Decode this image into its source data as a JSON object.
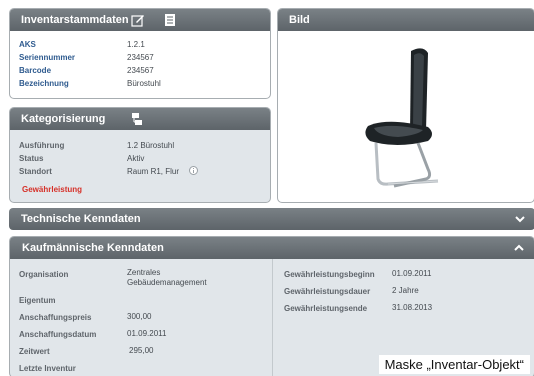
{
  "inventory": {
    "title": "Inventarstammdaten",
    "rows": [
      {
        "label": "AKS",
        "value": "1.2.1"
      },
      {
        "label": "Seriennummer",
        "value": "234567"
      },
      {
        "label": "Barcode",
        "value": "234567"
      },
      {
        "label": "Bezeichnung",
        "value": "Bürostuhl"
      }
    ]
  },
  "image_panel": {
    "title": "Bild"
  },
  "categorization": {
    "title": "Kategorisierung",
    "rows": [
      {
        "label": "Ausführung",
        "value": "1.2 Bürostuhl"
      },
      {
        "label": "Status",
        "value": "Aktiv"
      },
      {
        "label": "Standort",
        "value": "Raum R1, Flur"
      }
    ],
    "warranty_link": "Gewährleistung"
  },
  "technical": {
    "title": "Technische Kenndaten"
  },
  "commercial": {
    "title": "Kaufmännische Kenndaten",
    "left_rows": [
      {
        "label": "Organisation",
        "value": "Zentrales\nGebäudemanagement"
      },
      {
        "label": "Eigentum",
        "value": ""
      },
      {
        "label": "Anschaffungspreis",
        "value": "300,00"
      },
      {
        "label": "Anschaffungsdatum",
        "value": "01.09.2011"
      },
      {
        "label": "Zeitwert",
        "value": "295,00"
      },
      {
        "label": "Letzte Inventur",
        "value": ""
      }
    ],
    "right_rows": [
      {
        "label": "Gewährleistungsbeginn",
        "value": "01.09.2011"
      },
      {
        "label": "Gewährleistungsdauer",
        "value": "2 Jahre"
      },
      {
        "label": "Gewährleistungsende",
        "value": "31.08.2013"
      }
    ]
  },
  "caption": "Maske „Inventar-Objekt“",
  "colors": {
    "header": "#5d6469",
    "label_blue": "#2f5b8f",
    "warning_red": "#d63028",
    "panel_grey": "#e1e6ea"
  }
}
